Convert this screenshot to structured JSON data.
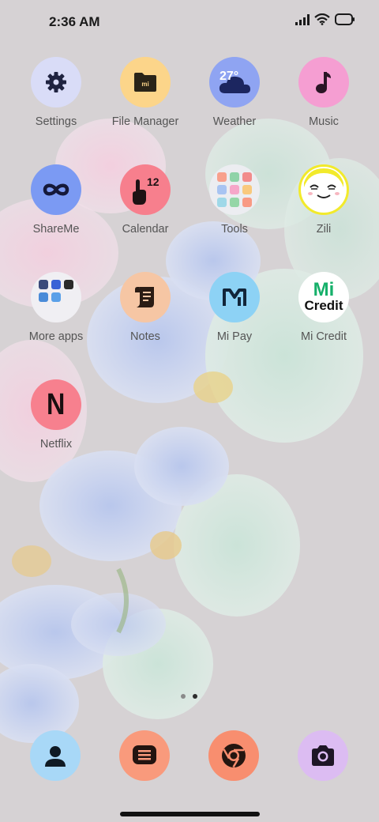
{
  "status_bar": {
    "time": "2:36 AM",
    "icons": [
      "signal-icon",
      "wifi-icon",
      "battery-icon"
    ]
  },
  "apps": [
    {
      "label": "Settings",
      "icon": "gear-icon",
      "bg": "#d9dcf7"
    },
    {
      "label": "File Manager",
      "icon": "folder-icon",
      "bg": "#fcd58a"
    },
    {
      "label": "Weather",
      "icon": "cloud-icon",
      "bg": "#8fa4f2",
      "badge": "27°"
    },
    {
      "label": "Music",
      "icon": "music-note-icon",
      "bg": "#f59ed2"
    },
    {
      "label": "ShareMe",
      "icon": "infinity-icon",
      "bg": "#7b9af3"
    },
    {
      "label": "Calendar",
      "icon": "calendar-hand-icon",
      "bg": "#f77f8d",
      "badge": "12"
    },
    {
      "label": "Tools",
      "icon": "folder-tools-icon",
      "bg": "#ecedf1"
    },
    {
      "label": "Zili",
      "icon": "zili-face-icon",
      "bg": "#ffffff"
    },
    {
      "label": "More apps",
      "icon": "folder-more-apps-icon",
      "bg": "#f0eff3"
    },
    {
      "label": "Notes",
      "icon": "notes-icon",
      "bg": "#f6c6a4"
    },
    {
      "label": "Mi Pay",
      "icon": "mi-pay-icon",
      "bg": "#8dd2f5",
      "badge": "Mi"
    },
    {
      "label": "Mi Credit",
      "icon": "mi-credit-icon",
      "bg": "#ffffff",
      "badge": "Mi",
      "badge2": "Credit"
    },
    {
      "label": "Netflix",
      "icon": "netflix-icon",
      "bg": "#f7808e",
      "badge": "N"
    }
  ],
  "dock": [
    {
      "name": "contacts",
      "icon": "person-icon",
      "bg": "#a8d8f7"
    },
    {
      "name": "messages",
      "icon": "message-icon",
      "bg": "#f99a7c"
    },
    {
      "name": "browser",
      "icon": "chrome-icon",
      "bg": "#f88e6f"
    },
    {
      "name": "camera",
      "icon": "camera-icon",
      "bg": "#dcbcf2"
    }
  ],
  "page_indicator": {
    "pages": 2,
    "current": 2
  },
  "colors": {
    "background": "#d6d2d4",
    "label": "#555555",
    "icon_dark": "#1f1f2a"
  }
}
